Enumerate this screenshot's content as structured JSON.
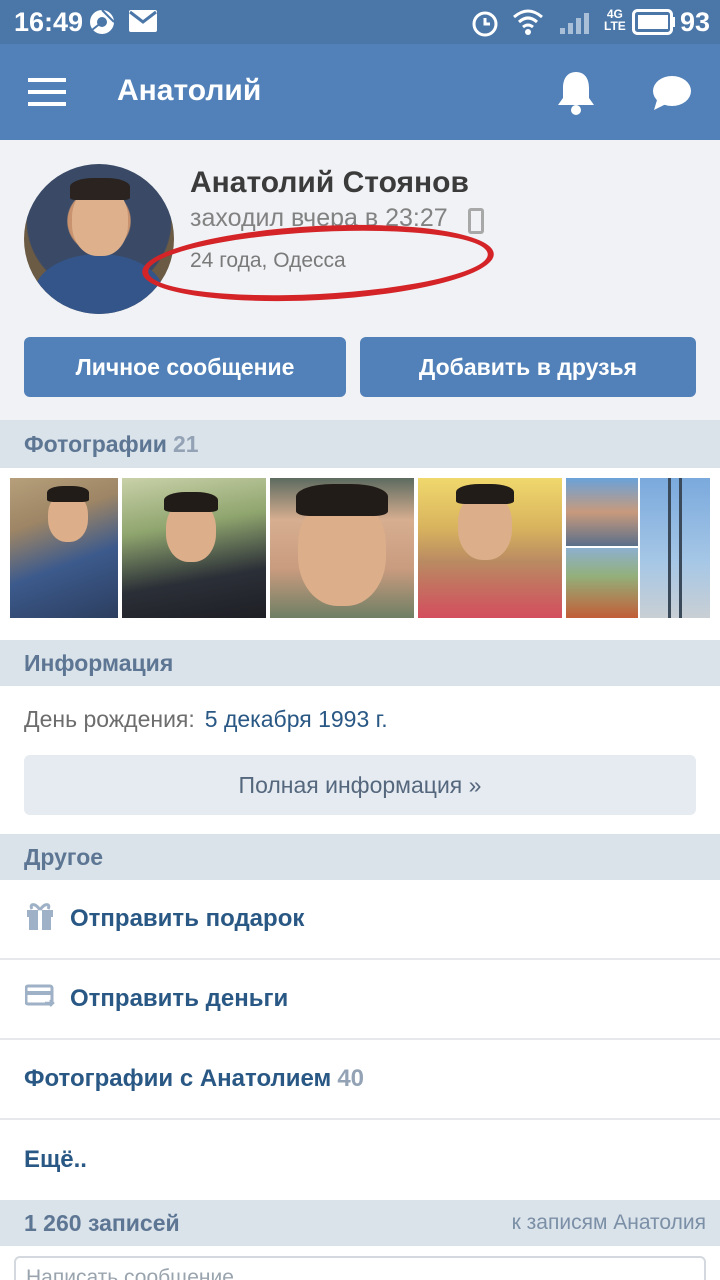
{
  "status_bar": {
    "time": "16:49",
    "network": "4G",
    "network_sub": "LTE",
    "battery": "93"
  },
  "header": {
    "title": "Анатолий"
  },
  "profile": {
    "name": "Анатолий Стоянов",
    "last_seen": "заходил вчера в 23:27",
    "age_city": "24 года, Одесса",
    "message_button": "Личное сообщение",
    "add_friend_button": "Добавить в друзья"
  },
  "photos": {
    "title": "Фотографии",
    "count": "21"
  },
  "info": {
    "title": "Информация",
    "birthday_label": "День рождения:",
    "birthday_value": "5 декабря 1993 г.",
    "full_info_button": "Полная информация »"
  },
  "other": {
    "title": "Другое",
    "send_gift": "Отправить подарок",
    "send_money": "Отправить деньги",
    "photos_with": "Фотографии с Анатолием",
    "photos_with_count": "40",
    "more": "Ещё.."
  },
  "posts": {
    "count_label": "1 260 записей",
    "link": "к записям Анатолия",
    "compose_placeholder": "Написать сообщение..."
  },
  "colors": {
    "header": "#5181b8",
    "status_bar": "#4a76a8",
    "annotation_circle": "#d42428",
    "link": "#2a5885"
  }
}
